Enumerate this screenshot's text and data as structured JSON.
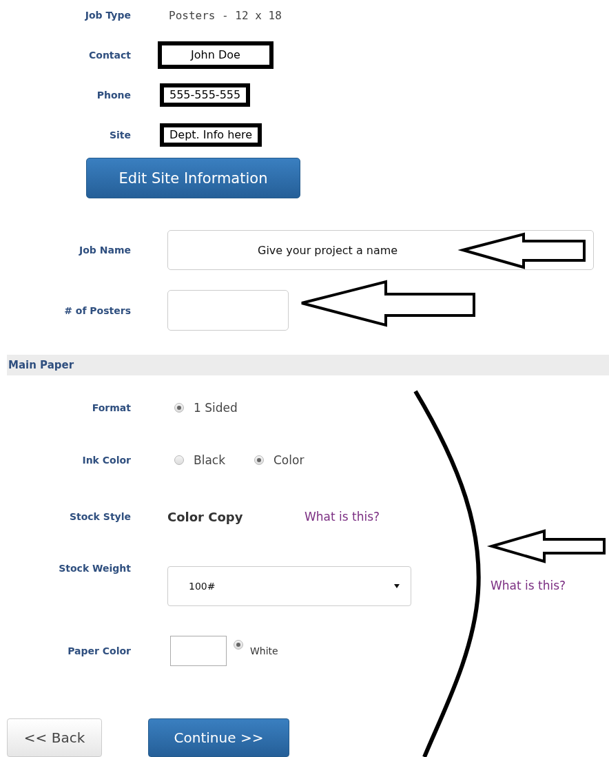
{
  "site_fields": [
    {
      "label": "Job Type",
      "kind": "plain",
      "value": "Posters - 12 x 18"
    },
    {
      "label": "Contact",
      "kind": "boxed",
      "value": "John Doe"
    },
    {
      "label": "Phone",
      "kind": "boxed",
      "value": "555-555-555"
    },
    {
      "label": "Site",
      "kind": "boxed",
      "value": "Dept. Info here"
    }
  ],
  "edit_button": "Edit Site Information",
  "job_name": {
    "label": "Job Name",
    "value": "Give your project a name"
  },
  "posters": {
    "label": "# of Posters"
  },
  "section": "Main Paper",
  "format": {
    "label": "Format",
    "options": [
      {
        "label": "1 Sided",
        "selected": true
      }
    ]
  },
  "ink_color": {
    "label": "Ink Color",
    "options": [
      {
        "label": "Black",
        "selected": false
      },
      {
        "label": "Color",
        "selected": true
      }
    ]
  },
  "stock_style": {
    "label": "Stock Style",
    "value": "Color Copy",
    "help": "What is this?"
  },
  "stock_weight": {
    "label": "Stock Weight",
    "value": "100#",
    "help": "What is this?"
  },
  "paper_color": {
    "label": "Paper Color",
    "options": [
      {
        "label": "White",
        "selected": true
      }
    ]
  },
  "buttons": [
    {
      "label": "<< Back",
      "kind": "secondary"
    },
    {
      "label": "Continue >>",
      "kind": "primary"
    }
  ]
}
